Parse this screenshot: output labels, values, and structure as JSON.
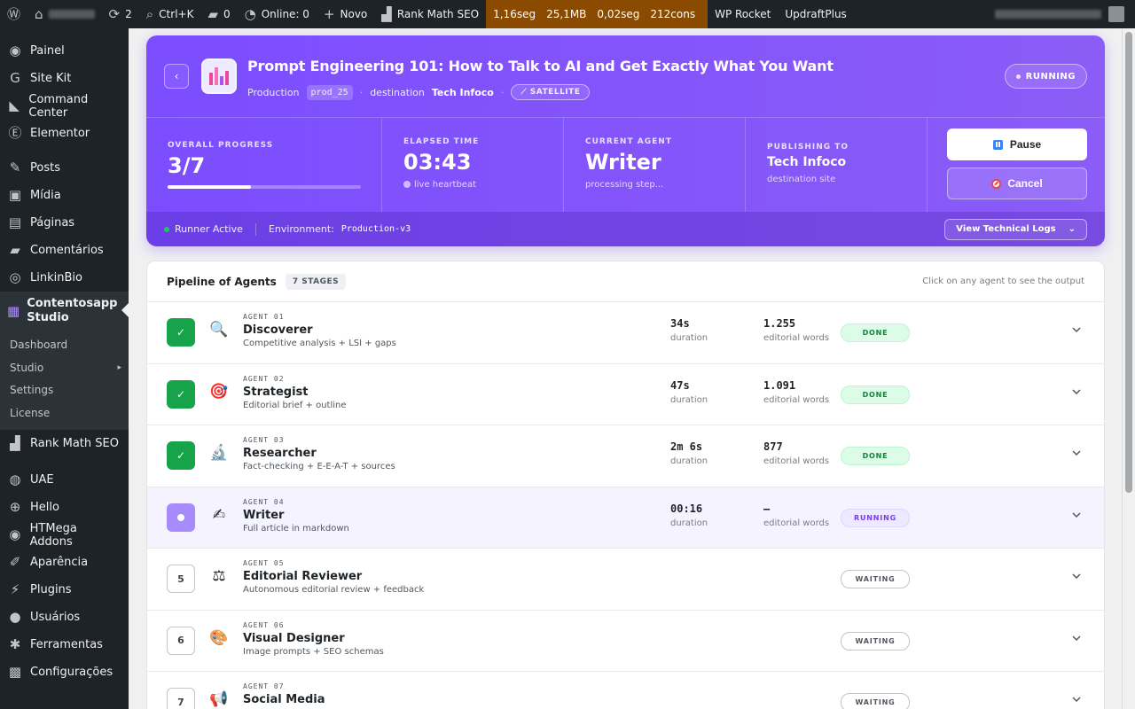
{
  "admin_bar": {
    "updates_count": "2",
    "search_shortcut": "Ctrl+K",
    "comments_count": "0",
    "online": "Online: 0",
    "new_label": "Novo",
    "rank_math": "Rank Math SEO",
    "perf_time": "1,16seg",
    "perf_mem": "25,1MB",
    "perf_query_time": "0,02seg",
    "perf_queries": "212cons",
    "wp_rocket": "WP Rocket",
    "updraft": "UpdraftPlus"
  },
  "sidebar": {
    "items_top": [
      {
        "label": "Painel",
        "icon": "gauge-icon"
      },
      {
        "label": "Site Kit",
        "icon": "g-icon"
      },
      {
        "label": "Command Center",
        "icon": "chart-icon"
      },
      {
        "label": "Elementor",
        "icon": "e-icon"
      }
    ],
    "items_mid": [
      {
        "label": "Posts",
        "icon": "pin-icon"
      },
      {
        "label": "Mídia",
        "icon": "media-icon"
      },
      {
        "label": "Páginas",
        "icon": "page-icon"
      },
      {
        "label": "Comentários",
        "icon": "comment-icon"
      },
      {
        "label": "LinkinBio",
        "icon": "instagram-icon"
      }
    ],
    "current": {
      "label": "Contentosapp Studio",
      "icon": "grid-icon"
    },
    "submenu": [
      "Dashboard",
      "Studio",
      "Settings",
      "License"
    ],
    "rank_math": "Rank Math SEO",
    "items_bottom": [
      {
        "label": "UAE",
        "icon": "uae-icon"
      },
      {
        "label": "Hello",
        "icon": "plus-circle-icon"
      },
      {
        "label": "HTMega Addons",
        "icon": "htmega-icon"
      },
      {
        "label": "Aparência",
        "icon": "brush-icon"
      },
      {
        "label": "Plugins",
        "icon": "plug-icon"
      },
      {
        "label": "Usuários",
        "icon": "user-icon"
      },
      {
        "label": "Ferramentas",
        "icon": "wrench-icon"
      },
      {
        "label": "Configurações",
        "icon": "settings-icon"
      }
    ]
  },
  "hero": {
    "title": "Prompt Engineering 101: How to Talk to AI and Get Exactly What You Want",
    "env_label": "Production",
    "env_chip": "prod_25",
    "dest_label": "destination",
    "dest_value": "Tech Infoco",
    "satellite": "SATELLITE",
    "status": "RUNNING",
    "stats": {
      "progress_label": "OVERALL PROGRESS",
      "progress_value": "3/7",
      "progress_fraction": 0.43,
      "elapsed_label": "ELAPSED TIME",
      "elapsed_value": "03:43",
      "elapsed_sub": "live heartbeat",
      "agent_label": "CURRENT AGENT",
      "agent_value": "Writer",
      "agent_sub": "processing step...",
      "publish_label": "PUBLISHING TO",
      "publish_value": "Tech Infoco",
      "publish_sub": "destination site"
    },
    "pause": "Pause",
    "cancel": "Cancel",
    "runner": "Runner Active",
    "env_text": "Environment:",
    "env_value": "Production-v3",
    "logs": "View Technical Logs"
  },
  "pipeline": {
    "title": "Pipeline of Agents",
    "stages": "7 STAGES",
    "hint": "Click on any agent to see the output",
    "duration_label": "duration",
    "words_label": "editorial words",
    "agents": [
      {
        "num": "AGENT 01",
        "name": "Discoverer",
        "desc": "Competitive analysis + LSI + gaps",
        "duration": "34s",
        "words": "1.255",
        "status": "DONE",
        "icon": "magnifier-icon",
        "badge": "✓"
      },
      {
        "num": "AGENT 02",
        "name": "Strategist",
        "desc": "Editorial brief + outline",
        "duration": "47s",
        "words": "1.091",
        "status": "DONE",
        "icon": "target-icon",
        "badge": "✓"
      },
      {
        "num": "AGENT 03",
        "name": "Researcher",
        "desc": "Fact-checking + E-E-A-T + sources",
        "duration": "2m 6s",
        "words": "877",
        "status": "DONE",
        "icon": "microscope-icon",
        "badge": "✓"
      },
      {
        "num": "AGENT 04",
        "name": "Writer",
        "desc": "Full article in markdown",
        "duration": "00:16",
        "words": "—",
        "status": "RUNNING",
        "icon": "writing-hand-icon",
        "badge": ""
      },
      {
        "num": "AGENT 05",
        "name": "Editorial Reviewer",
        "desc": "Autonomous editorial review + feedback",
        "status": "WAITING",
        "icon": "scales-icon",
        "badge": "5"
      },
      {
        "num": "AGENT 06",
        "name": "Visual Designer",
        "desc": "Image prompts + SEO schemas",
        "status": "WAITING",
        "icon": "palette-icon",
        "badge": "6"
      },
      {
        "num": "AGENT 07",
        "name": "Social Media",
        "desc": "",
        "status": "WAITING",
        "icon": "megaphone-icon",
        "badge": "7"
      }
    ]
  }
}
